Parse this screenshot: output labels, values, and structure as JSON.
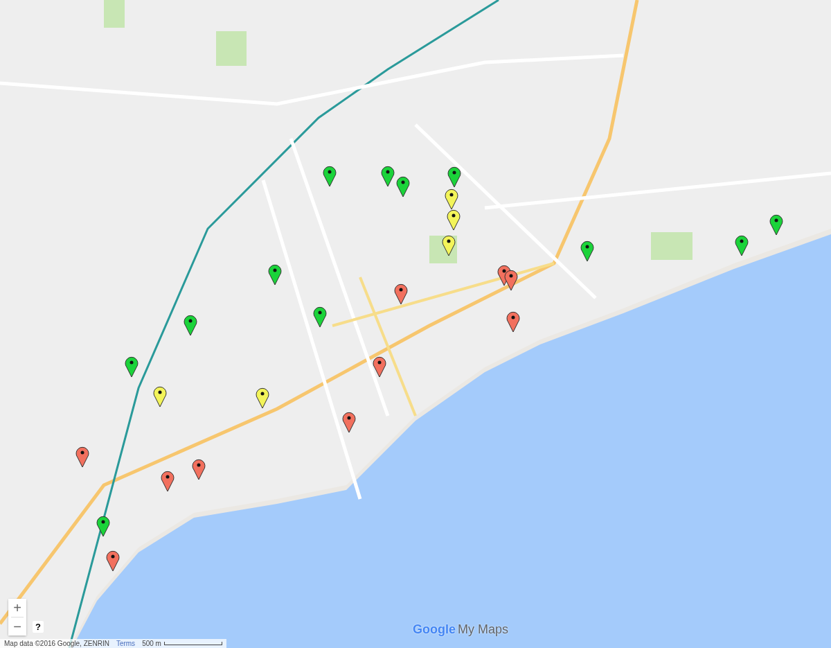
{
  "markers": [
    {
      "color": "#1bd33a"
    },
    {
      "color": "#1bd33a"
    },
    {
      "color": "#1bd33a"
    },
    {
      "color": "#1bd33a"
    },
    {
      "color": "#1bd33a"
    },
    {
      "color": "#1bd33a"
    },
    {
      "color": "#1bd33a"
    },
    {
      "color": "#1bd33a"
    },
    {
      "color": "#1bd33a"
    },
    {
      "color": "#1bd33a"
    },
    {
      "color": "#1bd33a"
    },
    {
      "color": "#1bd33a"
    },
    {
      "color": "#f3f45a"
    },
    {
      "color": "#f3f45a"
    },
    {
      "color": "#f3f45a"
    },
    {
      "color": "#f3f45a"
    },
    {
      "color": "#f3f45a"
    },
    {
      "color": "#f2705e"
    },
    {
      "color": "#f2705e"
    },
    {
      "color": "#f2705e"
    },
    {
      "color": "#f2705e"
    },
    {
      "color": "#f2705e"
    },
    {
      "color": "#f2705e"
    },
    {
      "color": "#f2705e"
    },
    {
      "color": "#f2705e"
    },
    {
      "color": "#f2705e"
    },
    {
      "color": "#f2705e"
    }
  ],
  "zoom_controls": {
    "zoom_in": "+",
    "zoom_out": "−"
  },
  "help": "?",
  "attribution": {
    "map_data": "Map data ©2016 Google, ZENRIN",
    "terms": "Terms",
    "scale": "500 m"
  },
  "logo": {
    "brand": "Google",
    "product": "My Maps"
  }
}
